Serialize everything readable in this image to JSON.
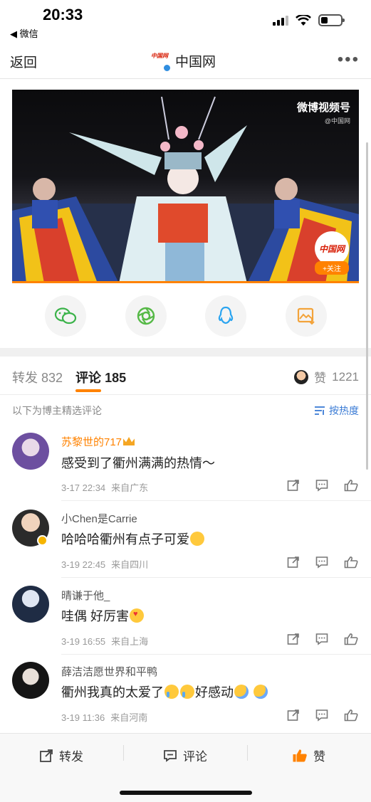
{
  "status_bar": {
    "time": "20:33",
    "back_app": "◀ 微信"
  },
  "nav": {
    "back": "返回",
    "title": "中国网",
    "logo_text": "中国网",
    "more": "•••"
  },
  "video": {
    "watermark": "微博视频号",
    "watermark_sub": "@中国网",
    "follow_logo": "中国网",
    "follow_label": "+关注"
  },
  "share_icons": [
    "wechat-icon",
    "moments-icon",
    "qq-icon",
    "save-image-icon"
  ],
  "tabs": {
    "repost_label": "转发",
    "repost_count": "832",
    "comment_label": "评论",
    "comment_count": "185",
    "like_label": "赞",
    "like_count": "1221"
  },
  "curated_label": "以下为博主精选评论",
  "sort_label": "按热度",
  "comments": [
    {
      "user": "苏黎世的717",
      "text": "感受到了衢州满满的热情～",
      "date": "3-17 22:34",
      "location": "来自广东",
      "name_color": "#ff8200"
    },
    {
      "user": "小Chen是Carrie",
      "text": "哈哈哈衢州有点子可爱",
      "date": "3-19 22:45",
      "location": "来自四川",
      "name_color": "#555555"
    },
    {
      "user": "晴谦于他_",
      "text": "哇偶 好厉害",
      "date": "3-19 16:55",
      "location": "来自上海",
      "name_color": "#555555"
    },
    {
      "user": "薛洁洁愿世界和平鸭",
      "text": "衢州我真的太爱了",
      "text2": "好感动",
      "date": "3-19 11:36",
      "location": "来自河南",
      "name_color": "#555555"
    }
  ],
  "bottom_bar": {
    "repost": "转发",
    "comment": "评论",
    "like": "赞"
  },
  "colors": {
    "accent": "#ff8200",
    "link": "#3a7bd5"
  }
}
